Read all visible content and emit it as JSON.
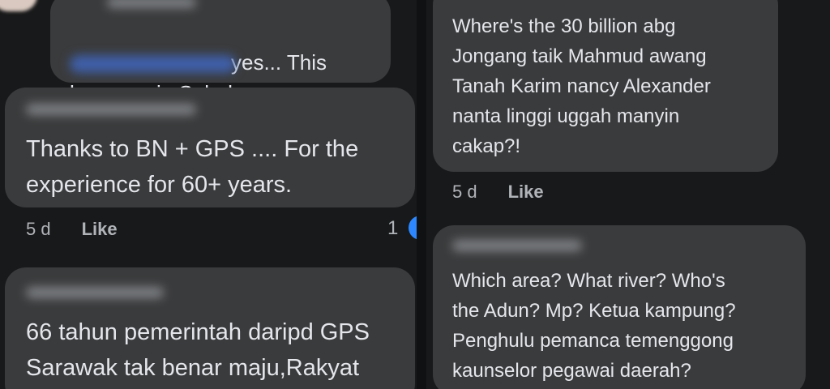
{
  "left": {
    "comment1": {
      "tail": "yes... This\nhappens in Sabah."
    },
    "comment2": {
      "text": "Thanks to BN + GPS .... For the\nexperience for 60+ years.",
      "age": "5 d",
      "like": "Like",
      "reactions": "1"
    },
    "comment3": {
      "text": "66 tahun pemerintah daripd GPS\nSarawak tak benar maju,Rakyat"
    }
  },
  "right": {
    "comment1": {
      "text": "Where's the 30 billion abg\nJongang taik Mahmud awang\nTanah Karim nancy Alexander\nnanta linggi uggah manyin\ncakap?!",
      "age": "5 d",
      "like": "Like"
    },
    "comment2": {
      "text": "Which area? What river? Who's\nthe Adun? Mp? Ketua kampung?\nPenghulu pemanca temenggong\nkaunselor pegawai daerah?"
    }
  }
}
